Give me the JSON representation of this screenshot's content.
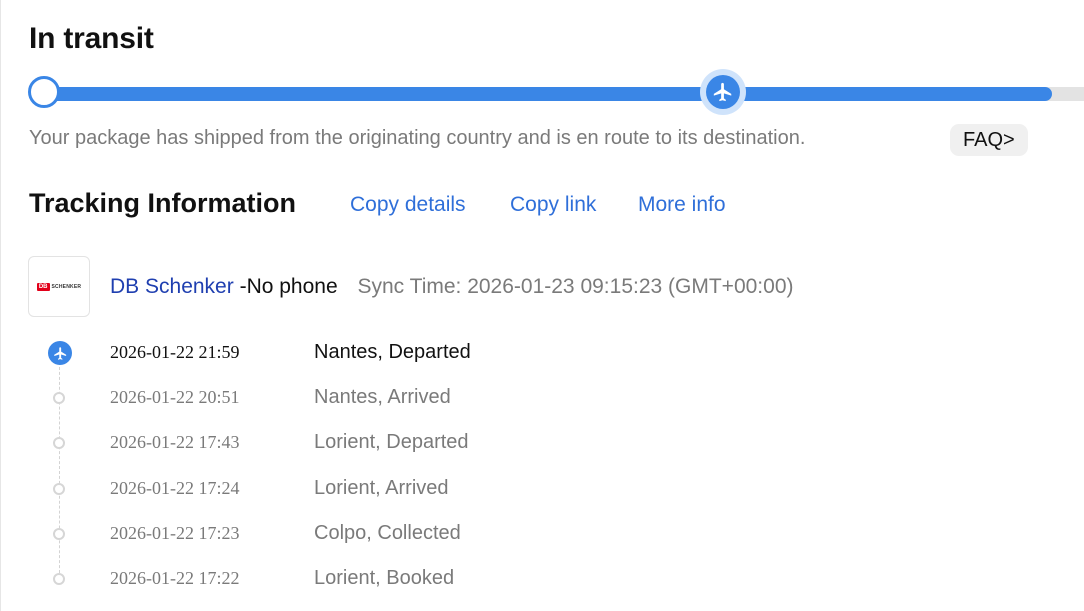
{
  "status": {
    "title": "In transit",
    "progress_percent": 97,
    "description": "Your package has shipped from the originating country and is en route to its destination.",
    "faq_label": "FAQ>"
  },
  "tracking": {
    "title": "Tracking Information",
    "actions": {
      "copy_details": "Copy details",
      "copy_link": "Copy link",
      "more_info": "More info"
    }
  },
  "carrier": {
    "logo_text": {
      "brand": "DB",
      "name": "SCHENKER"
    },
    "name": "DB Schenker",
    "separator": "-",
    "phone": "No phone",
    "sync_time": "Sync Time: 2026-01-23 09:15:23 (GMT+00:00)"
  },
  "events": [
    {
      "time": "2026-01-22 21:59",
      "location": "Nantes, Departed"
    },
    {
      "time": "2026-01-22 20:51",
      "location": "Nantes, Arrived"
    },
    {
      "time": "2026-01-22 17:43",
      "location": "Lorient, Departed"
    },
    {
      "time": "2026-01-22 17:24",
      "location": "Lorient, Arrived"
    },
    {
      "time": "2026-01-22 17:23",
      "location": "Colpo, Collected"
    },
    {
      "time": "2026-01-22 17:22",
      "location": "Lorient, Booked"
    }
  ],
  "colors": {
    "accent": "#3a86e6",
    "link": "#2f6fd9",
    "carrier_link": "#1f3fb0",
    "muted": "#7a7a7a"
  },
  "icons": {
    "progress_marker": "airplane-icon",
    "start_marker": "circle-icon",
    "event_dot": "dot-icon"
  }
}
